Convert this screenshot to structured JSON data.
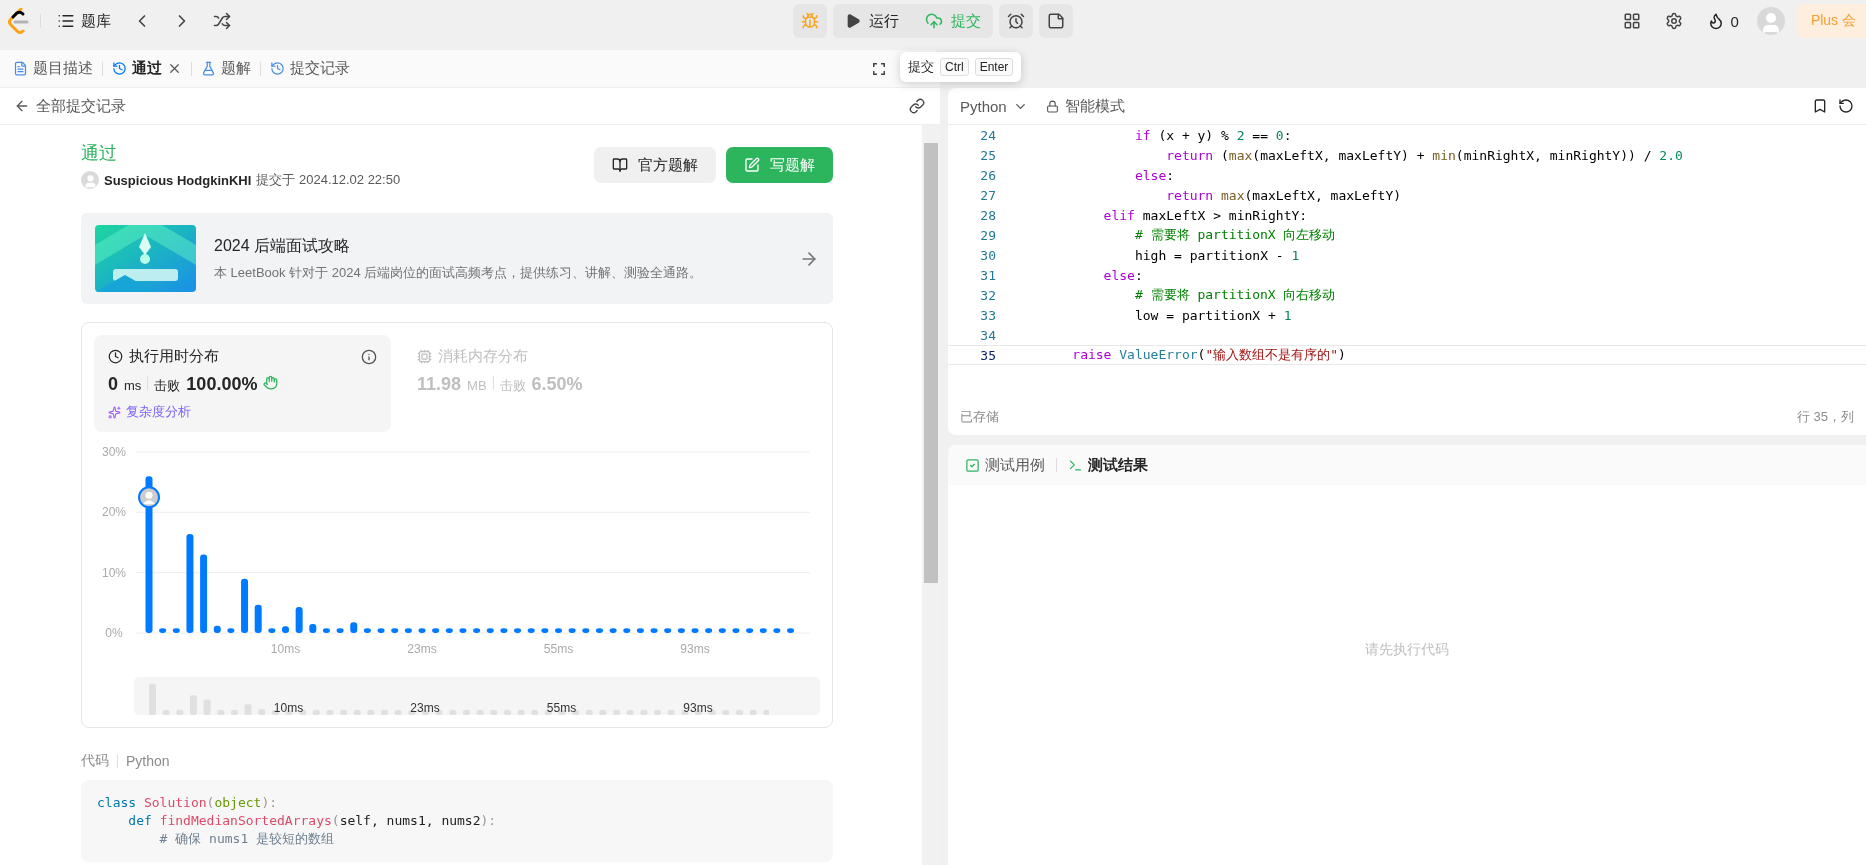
{
  "top_bar": {
    "problem_list": "题库",
    "run": "运行",
    "submit": "提交",
    "streak": "0",
    "plus": "Plus 会"
  },
  "left_tabs": [
    {
      "label": "题目描述",
      "selected": false,
      "closable": false
    },
    {
      "label": "通过",
      "selected": true,
      "closable": true
    },
    {
      "label": "题解",
      "selected": false,
      "closable": false
    },
    {
      "label": "提交记录",
      "selected": false,
      "closable": false
    }
  ],
  "tooltip": {
    "label": "提交",
    "keys": [
      "Ctrl",
      "Enter"
    ]
  },
  "submission_header": {
    "back": "全部提交记录"
  },
  "submission": {
    "status": "通过",
    "user": "Suspicious HodgkinKHI",
    "submitted": "提交于 2024.12.02 22:50",
    "buttons": [
      {
        "label": "官方题解",
        "kind": "secondary"
      },
      {
        "label": "写题解",
        "kind": "primary"
      }
    ]
  },
  "banner": {
    "kind": "picture",
    "title": "2024 后端面试攻略",
    "description": "本 LeetBook 针对于 2024 后端岗位的面试高频考点，提供练习、讲解、测验全通路。"
  },
  "stats": [
    {
      "kind": "runtime",
      "title": "执行用时分布",
      "value": "0",
      "unit": "ms",
      "beats_label": "击败",
      "beats": "100.00%",
      "selected": true,
      "link": "复杂度分析"
    },
    {
      "kind": "memory",
      "title": "消耗内存分布",
      "value": "11.98",
      "unit": "MB",
      "beats_label": "击败",
      "beats": "6.50%",
      "selected": false
    }
  ],
  "chart_data": {
    "type": "bar",
    "categories": [
      null,
      null,
      null,
      null,
      null,
      null,
      null,
      null,
      null,
      null,
      "10ms",
      null,
      null,
      null,
      null,
      null,
      null,
      null,
      null,
      null,
      "23ms",
      null,
      null,
      null,
      null,
      null,
      null,
      null,
      null,
      null,
      "55ms",
      null,
      null,
      null,
      null,
      null,
      null,
      null,
      null,
      null,
      "93ms",
      null,
      null,
      null,
      null,
      null,
      null,
      null
    ],
    "series": [
      {
        "color": "#007aff",
        "values": [
          26.0,
          0.8,
          0.8,
          16.4,
          13.0,
          1.2,
          0.8,
          9.0,
          4.7,
          0.8,
          1.1,
          4.3,
          1.5,
          0.8,
          0.8,
          1.8,
          0.8,
          0.8,
          0.8,
          0.8,
          0.8,
          0.8,
          0.8,
          0.8,
          0.8,
          0.8,
          0.8,
          0.8,
          0.8,
          0.8,
          0.8,
          0.8,
          0.8,
          0.8,
          0.8,
          0.8,
          0.8,
          0.8,
          0.8,
          0.8,
          0.8,
          0.8,
          0.8,
          0.8,
          0.8,
          0.8,
          0.8,
          0.8
        ]
      }
    ],
    "ylim": [
      0,
      30
    ],
    "yticks": [
      {
        "value": 0,
        "label": "0%"
      },
      {
        "value": 10,
        "label": "10%"
      },
      {
        "value": 20,
        "label": "20%"
      },
      {
        "value": 30,
        "label": "30%"
      }
    ]
  },
  "overview_labels": [
    "10ms",
    "23ms",
    "55ms",
    "93ms"
  ],
  "code_section": {
    "label": "代码",
    "language": "Python",
    "lines": [
      [
        {
          "kind": "kw",
          "text": "class "
        },
        {
          "kind": "title",
          "text": "Solution"
        },
        {
          "kind": "punct",
          "text": "("
        },
        {
          "kind": "builtin",
          "text": "object"
        },
        {
          "kind": "punct",
          "text": "):"
        }
      ],
      [
        {
          "kind": "kw",
          "text": "    def "
        },
        {
          "kind": "title",
          "text": "findMedianSortedArrays"
        },
        {
          "kind": "punct",
          "text": "("
        },
        {
          "kind": "plain",
          "text": "self, nums1, nums2"
        },
        {
          "kind": "punct",
          "text": "):"
        }
      ],
      [
        {
          "kind": "comment",
          "text": "        # 确保 nums1 是较短的数组"
        }
      ]
    ]
  },
  "editor": {
    "language": "Python",
    "mode": "智能模式",
    "status": "已存储",
    "cursor": "行 35，列",
    "lines": [
      {
        "number": "24",
        "current": false,
        "tokens": [
          {
            "kind": "kw",
            "text": "            if"
          },
          {
            "kind": "plain",
            "text": " (x + y) % "
          },
          {
            "kind": "num",
            "text": "2"
          },
          {
            "kind": "plain",
            "text": " == "
          },
          {
            "kind": "num",
            "text": "0"
          },
          {
            "kind": "plain",
            "text": ":"
          }
        ]
      },
      {
        "number": "25",
        "current": false,
        "tokens": [
          {
            "kind": "kw",
            "text": "                return"
          },
          {
            "kind": "plain",
            "text": " ("
          },
          {
            "kind": "fn",
            "text": "max"
          },
          {
            "kind": "plain",
            "text": "(maxLeftX, maxLeftY) + "
          },
          {
            "kind": "fn",
            "text": "min"
          },
          {
            "kind": "plain",
            "text": "(minRightX, minRightY)) / "
          },
          {
            "kind": "num",
            "text": "2.0"
          }
        ]
      },
      {
        "number": "26",
        "current": false,
        "tokens": [
          {
            "kind": "kw",
            "text": "            else"
          },
          {
            "kind": "plain",
            "text": ":"
          }
        ]
      },
      {
        "number": "27",
        "current": false,
        "tokens": [
          {
            "kind": "kw",
            "text": "                return"
          },
          {
            "kind": "fn",
            "text": " max"
          },
          {
            "kind": "plain",
            "text": "(maxLeftX, maxLeftY)"
          }
        ]
      },
      {
        "number": "28",
        "current": false,
        "tokens": [
          {
            "kind": "kw",
            "text": "        elif"
          },
          {
            "kind": "plain",
            "text": " maxLeftX > minRightY:"
          }
        ]
      },
      {
        "number": "29",
        "current": false,
        "tokens": [
          {
            "kind": "cm",
            "text": "            # 需要将 partitionX 向左移动"
          }
        ]
      },
      {
        "number": "30",
        "current": false,
        "tokens": [
          {
            "kind": "plain",
            "text": "            high = partitionX - "
          },
          {
            "kind": "num",
            "text": "1"
          }
        ]
      },
      {
        "number": "31",
        "current": false,
        "tokens": [
          {
            "kind": "kw",
            "text": "        else"
          },
          {
            "kind": "plain",
            "text": ":"
          }
        ]
      },
      {
        "number": "32",
        "current": false,
        "tokens": [
          {
            "kind": "cm",
            "text": "            # 需要将 partitionX 向右移动"
          }
        ]
      },
      {
        "number": "33",
        "current": false,
        "tokens": [
          {
            "kind": "plain",
            "text": "            low = partitionX + "
          },
          {
            "kind": "num",
            "text": "1"
          }
        ]
      },
      {
        "number": "34",
        "current": false
      },
      {
        "number": "35",
        "current": true,
        "tokens": [
          {
            "kind": "kw",
            "text": "    raise"
          },
          {
            "kind": "type",
            "text": " ValueError"
          },
          {
            "kind": "plain",
            "text": "("
          },
          {
            "kind": "str",
            "text": "\"输入数组不是有序的\""
          },
          {
            "kind": "plain",
            "text": ")"
          }
        ]
      }
    ]
  },
  "result_tabs": [
    {
      "label": "测试用例",
      "selected": false
    },
    {
      "label": "测试结果",
      "selected": true
    }
  ],
  "result_placeholder": "请先执行代码"
}
